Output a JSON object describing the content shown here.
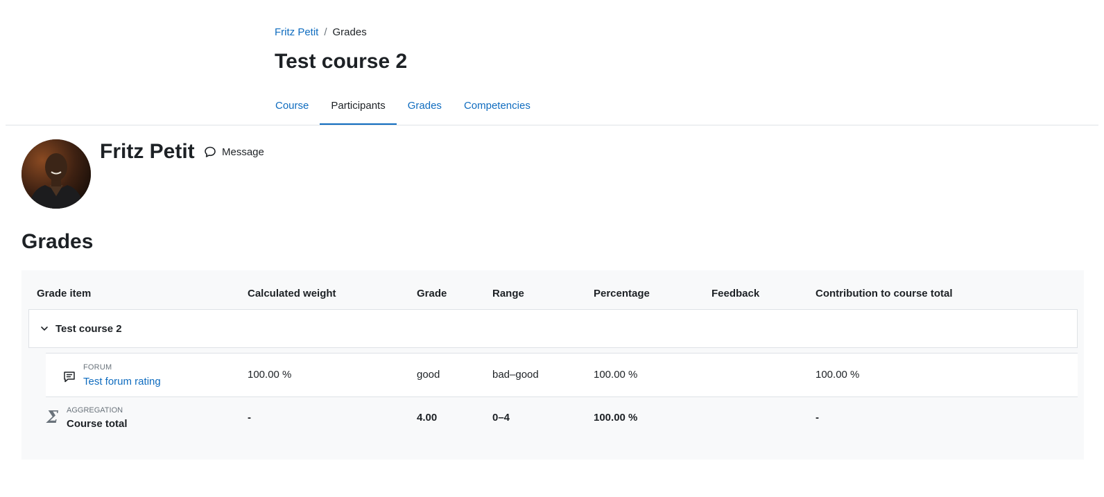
{
  "breadcrumb": {
    "parent": "Fritz Petit",
    "current": "Grades"
  },
  "course": {
    "title": "Test course 2"
  },
  "tabs": [
    {
      "label": "Course"
    },
    {
      "label": "Participants",
      "active": true
    },
    {
      "label": "Grades"
    },
    {
      "label": "Competencies"
    }
  ],
  "profile": {
    "name": "Fritz Petit",
    "message_label": "Message"
  },
  "grades": {
    "title": "Grades",
    "columns": {
      "item": "Grade item",
      "weight": "Calculated weight",
      "grade": "Grade",
      "range": "Range",
      "percentage": "Percentage",
      "feedback": "Feedback",
      "contribution": "Contribution to course total"
    },
    "category": {
      "name": "Test course 2"
    },
    "item": {
      "type": "FORUM",
      "name": "Test forum rating",
      "weight": "100.00 %",
      "grade": "good",
      "range": "bad–good",
      "percentage": "100.00 %",
      "feedback": "",
      "contribution": "100.00 %"
    },
    "total": {
      "type": "AGGREGATION",
      "name": "Course total",
      "weight": "-",
      "grade": "4.00",
      "range": "0–4",
      "percentage": "100.00 %",
      "feedback": "",
      "contribution": "-"
    }
  },
  "colors": {
    "link": "#0f6cbf",
    "text": "#1d2125",
    "muted": "#6a737b",
    "panel": "#f8f9fa",
    "border": "#dee2e6"
  },
  "icons": {
    "message": "message-icon",
    "forum": "forum-icon",
    "sigma": "sigma-icon",
    "collapse": "chevron-down-icon"
  }
}
